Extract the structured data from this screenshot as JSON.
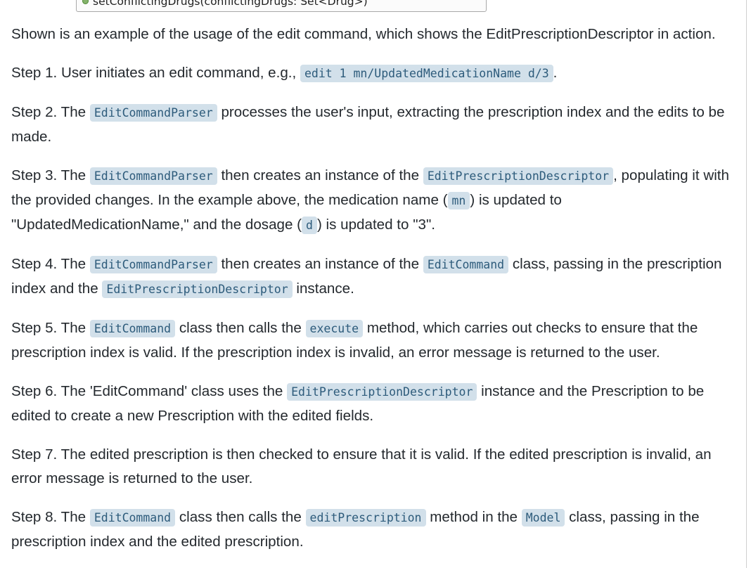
{
  "uml": {
    "method": "setConflictingDrugs(conflictingDrugs: Set<Drug>)"
  },
  "intro": "Shown is an example of the usage of the edit command, which shows the EditPrescriptionDescriptor in action.",
  "steps": {
    "s1": {
      "t1": "Step 1. User initiates an edit command, e.g., ",
      "c1": "edit 1 mn/UpdatedMedicationName d/3",
      "t2": "."
    },
    "s2": {
      "t1": "Step 2. The ",
      "c1": "EditCommandParser",
      "t2": " processes the user's input, extracting the prescription index and the edits to be made."
    },
    "s3": {
      "t1": "Step 3. The ",
      "c1": "EditCommandParser",
      "t2": " then creates an instance of the ",
      "c2": "EditPrescriptionDescriptor",
      "t3": ", populating it with the provided changes. In the example above, the medication name (",
      "c3": "mn",
      "t4": ") is updated to \"UpdatedMedicationName,\" and the dosage (",
      "c4": "d",
      "t5": ") is updated to \"3\"."
    },
    "s4": {
      "t1": "Step 4. The ",
      "c1": "EditCommandParser",
      "t2": " then creates an instance of the ",
      "c2": "EditCommand",
      "t3": " class, passing in the prescription index and the ",
      "c3": "EditPrescriptionDescriptor",
      "t4": " instance."
    },
    "s5": {
      "t1": "Step 5. The ",
      "c1": "EditCommand",
      "t2": " class then calls the ",
      "c2": "execute",
      "t3": " method, which carries out checks to ensure that the prescription index is valid. If the prescription index is invalid, an error message is returned to the user."
    },
    "s6": {
      "t1": "Step 6. The 'EditCommand' class uses the ",
      "c1": "EditPrescriptionDescriptor",
      "t2": " instance and the Prescription to be edited to create a new Prescription with the edited fields."
    },
    "s7": {
      "t1": "Step 7. The edited prescription is then checked to ensure that it is valid. If the edited prescription is invalid, an error message is returned to the user."
    },
    "s8": {
      "t1": "Step 8. The ",
      "c1": "EditCommand",
      "t2": " class then calls the ",
      "c2": "editPrescription",
      "t3": " method in the ",
      "c3": "Model",
      "t4": " class, passing in the prescription index and the edited prescription."
    }
  }
}
